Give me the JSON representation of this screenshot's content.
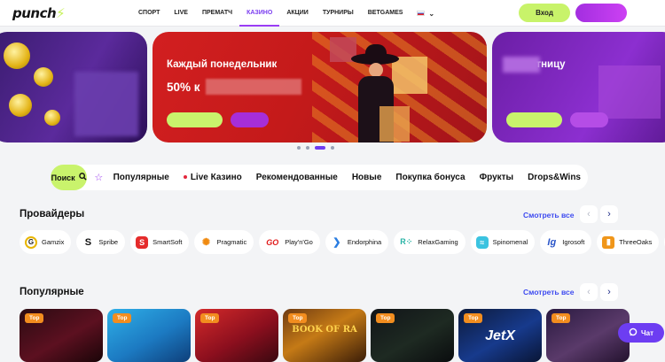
{
  "header": {
    "logo": "punch",
    "nav": [
      "СПОРТ",
      "LIVE",
      "ПРЕМАТЧ",
      "КАЗИНО",
      "АКЦИИ",
      "ТУРНИРЫ",
      "BETGAMES"
    ],
    "active_nav": "КАЗИНО",
    "language_icon": "russia-flag-icon",
    "login_label": "Вход",
    "register_label": ""
  },
  "banners": [
    {
      "title": "",
      "text": ""
    },
    {
      "title": "Каждый понедельник",
      "text": "50% к"
    },
    {
      "title": "...о пятницу",
      "text": ""
    }
  ],
  "carousel": {
    "count": 4,
    "active": 2
  },
  "categories": {
    "search_label": "Поиск",
    "items": [
      "Популярные",
      "Live Казино",
      "Рекомендованные",
      "Новые",
      "Покупка бонуса",
      "Фрукты",
      "Drops&Wins"
    ]
  },
  "providers_section": {
    "title": "Провайдеры",
    "see_all": "Смотреть все",
    "items": [
      "Gamzix",
      "Spribe",
      "SmartSoft",
      "Pragmatic",
      "Play'n'Go",
      "Endorphina",
      "RelaxGaming",
      "Spinomenal",
      "Igrosoft",
      "ThreeOaks"
    ]
  },
  "popular_section": {
    "title": "Популярные",
    "see_all": "Смотреть все",
    "badge": "Top",
    "games": [
      {
        "label": ""
      },
      {
        "label": ""
      },
      {
        "label": ""
      },
      {
        "label": "BOOK OF RA"
      },
      {
        "label": ""
      },
      {
        "label": "JetX"
      },
      {
        "label": ""
      }
    ]
  },
  "chat_label": "Чат",
  "colors": {
    "accent_lime": "#c9f36c",
    "accent_purple": "#9a3df5",
    "link_blue": "#3e4bf0",
    "badge_orange": "#f28d1f"
  }
}
